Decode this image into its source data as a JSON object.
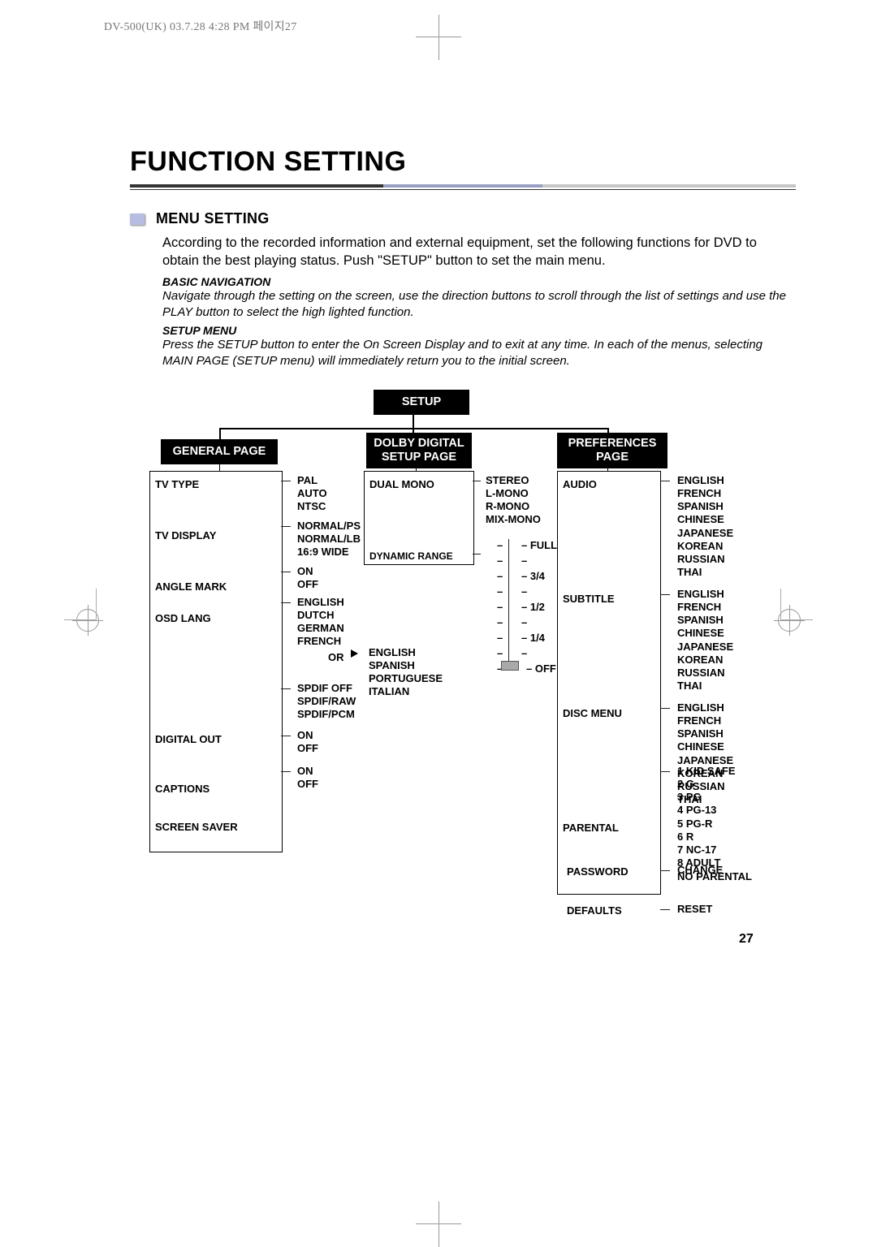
{
  "header_meta": "DV-500(UK)  03.7.28 4:28 PM  페이지27",
  "title": "FUNCTION SETTING",
  "subhead": "MENU SETTING",
  "intro": "According to the recorded information and external equipment, set the following functions for DVD to obtain the best playing status. Push \"SETUP\" button to set the main menu.",
  "nav_head": "BASIC NAVIGATION",
  "nav_body": "Navigate through the setting on the screen, use the direction buttons to scroll through the list of settings and use the PLAY button to select the high lighted function.",
  "setup_head": "SETUP MENU",
  "setup_body": "Press the SETUP button to enter the On Screen Display and to exit at any time. In each of the menus, selecting MAIN PAGE (SETUP menu) will immediately return you to the initial screen.",
  "labels": {
    "setup": "SETUP",
    "general_page": "GENERAL PAGE",
    "dolby_page1": "DOLBY DIGITAL",
    "dolby_page2": "SETUP PAGE",
    "pref_page1": "PREFERENCES",
    "pref_page2": "PAGE",
    "or": "OR"
  },
  "general": {
    "tv_type": "TV TYPE",
    "tv_type_opts": [
      "PAL",
      "AUTO",
      "NTSC"
    ],
    "tv_display": "TV DISPLAY",
    "tv_display_opts": [
      "NORMAL/PS",
      "NORMAL/LB",
      "16:9 WIDE"
    ],
    "angle_mark": "ANGLE MARK",
    "angle_mark_opts": [
      "ON",
      "OFF"
    ],
    "osd_lang": "OSD LANG",
    "osd_lang_opts": [
      "ENGLISH",
      "DUTCH",
      "GERMAN",
      "FRENCH"
    ],
    "osd_lang_or": [
      "ENGLISH",
      "SPANISH",
      "PORTUGUESE",
      "ITALIAN"
    ],
    "digital_out": "DIGITAL OUT",
    "digital_out_opts": [
      "SPDIF OFF",
      "SPDIF/RAW",
      "SPDIF/PCM"
    ],
    "captions": "CAPTIONS",
    "captions_opts": [
      "ON",
      "OFF"
    ],
    "screen_saver": "SCREEN SAVER",
    "screen_saver_opts": [
      "ON",
      "OFF"
    ]
  },
  "dolby": {
    "dual_mono": "DUAL MONO",
    "dual_mono_opts": [
      "STEREO",
      "L-MONO",
      "R-MONO",
      "MIX-MONO"
    ],
    "dyn_range": "DYNAMIC RANGE",
    "dyn_range_opts": [
      "FULL",
      "",
      "3/4",
      "",
      "1/2",
      "",
      "1/4",
      "",
      "OFF"
    ]
  },
  "prefs": {
    "audio": "AUDIO",
    "subtitle": "SUBTITLE",
    "disc_menu": "DISC MENU",
    "lang_opts": [
      "ENGLISH",
      "FRENCH",
      "SPANISH",
      "CHINESE",
      "JAPANESE",
      "KOREAN",
      "RUSSIAN",
      "THAI"
    ],
    "parental": "PARENTAL",
    "parental_opts": [
      "1 KID SAFE",
      "2 G",
      "3 PG",
      "4 PG-13",
      "5 PG-R",
      "6 R",
      "7 NC-17",
      "8 ADULT",
      "NO PARENTAL"
    ],
    "password": "PASSWORD",
    "password_opt": "CHANGE",
    "defaults": "DEFAULTS",
    "defaults_opt": "RESET"
  },
  "page_number": "27"
}
